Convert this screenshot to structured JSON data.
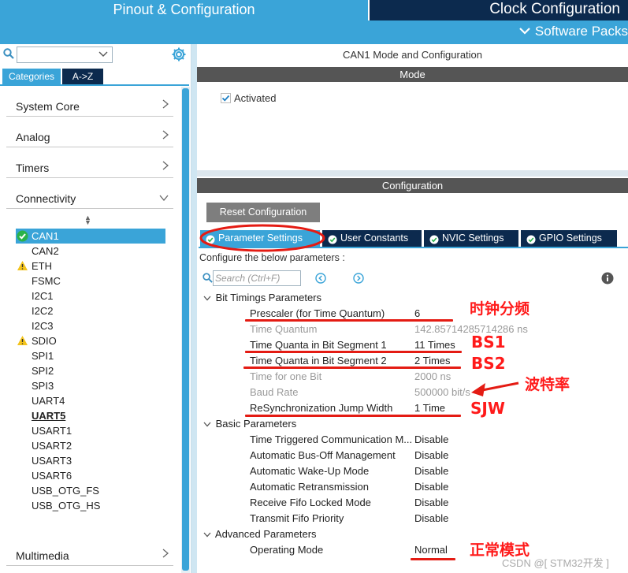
{
  "header": {
    "pinout_tab": "Pinout & Configuration",
    "clock_tab": "Clock Configuration",
    "software_packs": "Software Packs"
  },
  "left": {
    "tabs": [
      "Categories",
      "A->Z"
    ],
    "categories": [
      "System Core",
      "Analog",
      "Timers",
      "Connectivity"
    ],
    "peripherals": [
      {
        "name": "CAN1",
        "status": "ok",
        "selected": true
      },
      {
        "name": "CAN2"
      },
      {
        "name": "ETH",
        "status": "warning"
      },
      {
        "name": "FSMC"
      },
      {
        "name": "I2C1"
      },
      {
        "name": "I2C2"
      },
      {
        "name": "I2C3"
      },
      {
        "name": "SDIO",
        "status": "warning"
      },
      {
        "name": "SPI1"
      },
      {
        "name": "SPI2"
      },
      {
        "name": "SPI3"
      },
      {
        "name": "UART4"
      },
      {
        "name": "UART5",
        "bold": true
      },
      {
        "name": "USART1"
      },
      {
        "name": "USART2"
      },
      {
        "name": "USART3"
      },
      {
        "name": "USART6"
      },
      {
        "name": "USB_OTG_FS"
      },
      {
        "name": "USB_OTG_HS"
      }
    ],
    "multimedia": "Multimedia"
  },
  "right": {
    "title": "CAN1 Mode and Configuration",
    "mode_bar": "Mode",
    "activated_label": "Activated",
    "config_bar": "Configuration",
    "reset_button": "Reset Configuration",
    "tabs": [
      "Parameter Settings",
      "User Constants",
      "NVIC Settings",
      "GPIO Settings"
    ],
    "configure_label": "Configure the below parameters :",
    "search_placeholder": "Search (Ctrl+F)",
    "groups": {
      "bit_timings": "Bit Timings Parameters",
      "basic": "Basic Parameters",
      "advanced": "Advanced Parameters"
    },
    "bit_timing_rows": [
      {
        "name": "Prescaler (for Time Quantum)",
        "value": "6"
      },
      {
        "name": "Time Quantum",
        "value": "142.85714285714286 ns"
      },
      {
        "name": "Time Quanta in Bit Segment 1",
        "value": "11 Times"
      },
      {
        "name": "Time Quanta in Bit Segment 2",
        "value": "2 Times"
      },
      {
        "name": "Time for one Bit",
        "value": "2000 ns"
      },
      {
        "name": "Baud Rate",
        "value": "500000 bit/s"
      },
      {
        "name": "ReSynchronization Jump Width",
        "value": "1 Time"
      }
    ],
    "basic_rows": [
      {
        "name": "Time Triggered Communication M...",
        "value": "Disable"
      },
      {
        "name": "Automatic Bus-Off Management",
        "value": "Disable"
      },
      {
        "name": "Automatic Wake-Up Mode",
        "value": "Disable"
      },
      {
        "name": "Automatic Retransmission",
        "value": "Disable"
      },
      {
        "name": "Receive Fifo Locked Mode",
        "value": "Disable"
      },
      {
        "name": "Transmit Fifo Priority",
        "value": "Disable"
      }
    ],
    "advanced_rows": [
      {
        "name": "Operating Mode",
        "value": "Normal"
      }
    ]
  },
  "annotations": {
    "prescaler": "时钟分频",
    "bs1": "BS1",
    "bs2": "BS2",
    "baud": "波特率",
    "sjw": "SJW",
    "normal": "正常模式",
    "color": "#ff1a1a"
  },
  "watermark": "CSDN @[ STM32开发 ]",
  "colors": {
    "accent": "#3aa4d8",
    "dark_navy": "#0c2a4e",
    "ok_green": "#2ab24a",
    "warning_yellow": "#f3c31b"
  }
}
